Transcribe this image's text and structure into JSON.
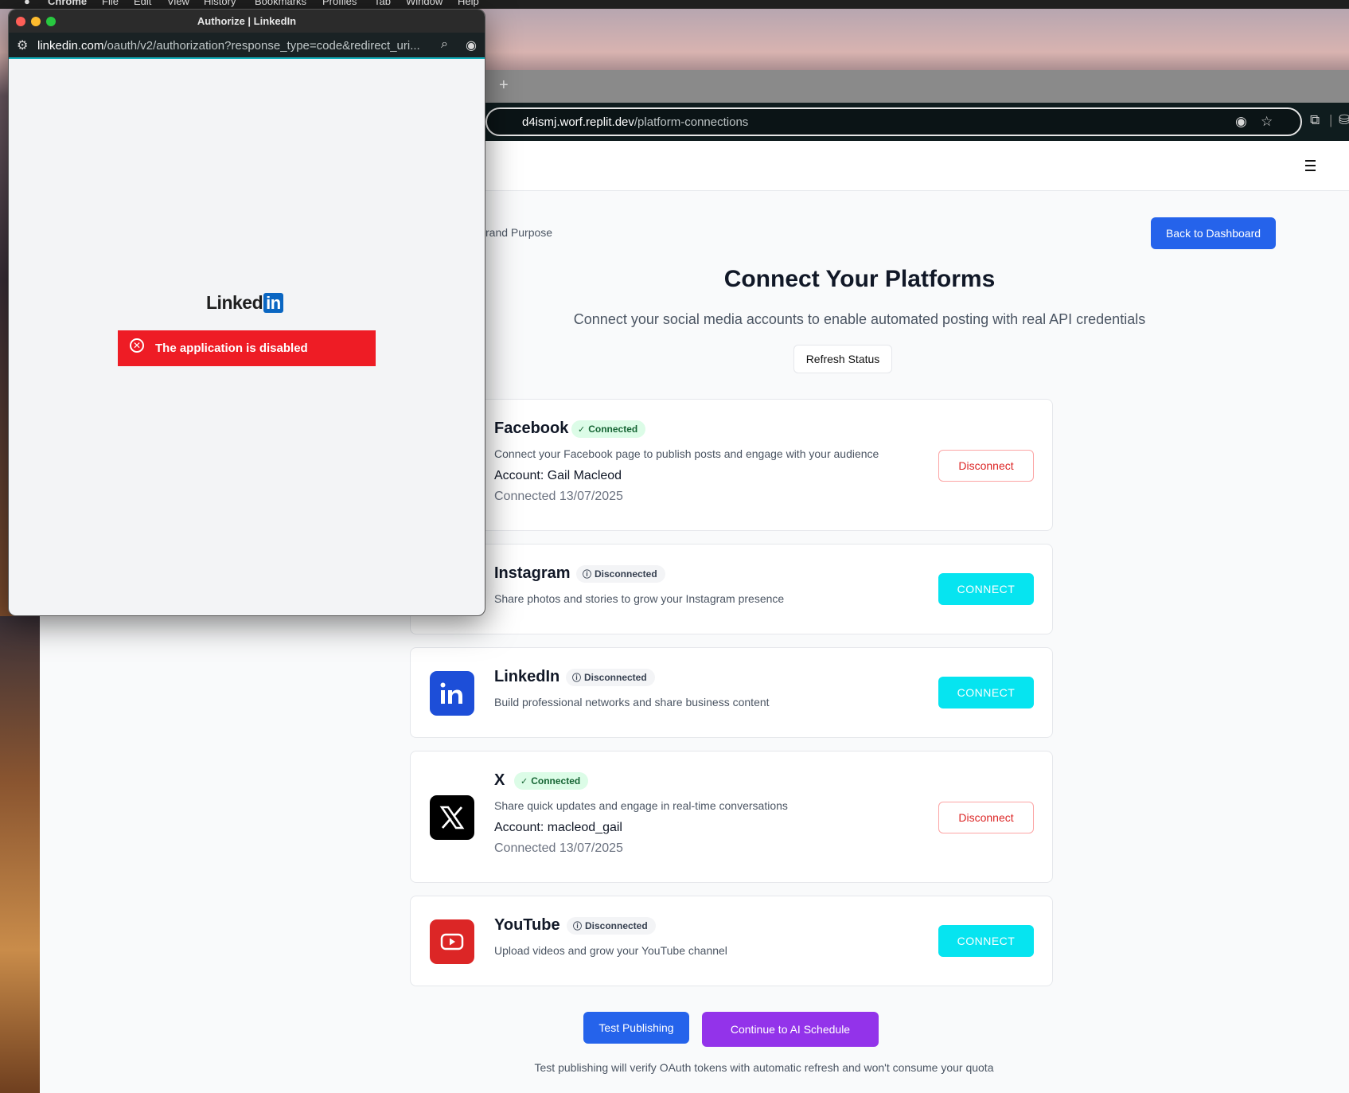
{
  "menubar": {
    "items": [
      "Chrome",
      "File",
      "Edit",
      "View",
      "History",
      "Bookmarks",
      "Profiles",
      "Tab",
      "Window",
      "Help"
    ]
  },
  "popup": {
    "title": "Authorize | LinkedIn",
    "url_host": "linkedin.com",
    "url_path": "/oauth/v2/authorization?response_type=code&redirect_uri...",
    "logo_text": "Linked",
    "logo_in": "in",
    "error_message": "The application is disabled"
  },
  "browser": {
    "new_tab": "+",
    "url_host": "d4ismj.worf.replit.dev",
    "url_path": "/platform-connections"
  },
  "page": {
    "breadcrumb": "rand Purpose",
    "back_button": "Back to Dashboard",
    "title": "Connect Your Platforms",
    "subtitle": "Connect your social media accounts to enable automated posting with real API credentials",
    "refresh_button": "Refresh Status",
    "test_button": "Test Publishing",
    "continue_button": "Continue to AI Schedule",
    "footer_note": "Test publishing will verify OAuth tokens with automatic refresh and won't consume your quota"
  },
  "platforms": [
    {
      "name": "Facebook",
      "status": "Connected",
      "description": "Connect your Facebook page to publish posts and engage with your audience",
      "account": "Account: Gail Macleod",
      "connected_on": "Connected 13/07/2025",
      "action": "Disconnect"
    },
    {
      "name": "Instagram",
      "status": "Disconnected",
      "description": "Share photos and stories to grow your Instagram presence",
      "action": "CONNECT"
    },
    {
      "name": "LinkedIn",
      "status": "Disconnected",
      "description": "Build professional networks and share business content",
      "action": "CONNECT",
      "icon": "linkedin-icon",
      "color": "#1d4ed8"
    },
    {
      "name": "X",
      "status": "Connected",
      "description": "Share quick updates and engage in real-time conversations",
      "account": "Account: macleod_gail",
      "connected_on": "Connected 13/07/2025",
      "action": "Disconnect",
      "icon": "x-icon",
      "color": "#000000"
    },
    {
      "name": "YouTube",
      "status": "Disconnected",
      "description": "Upload videos and grow your YouTube channel",
      "action": "CONNECT",
      "icon": "youtube-icon",
      "color": "#dc2626"
    }
  ],
  "colors": {
    "primary": "#2563eb",
    "connect": "#06e4f0",
    "continue": "#9333ea",
    "danger": "#dc2626",
    "linkedin_error": "#ee1c25"
  }
}
